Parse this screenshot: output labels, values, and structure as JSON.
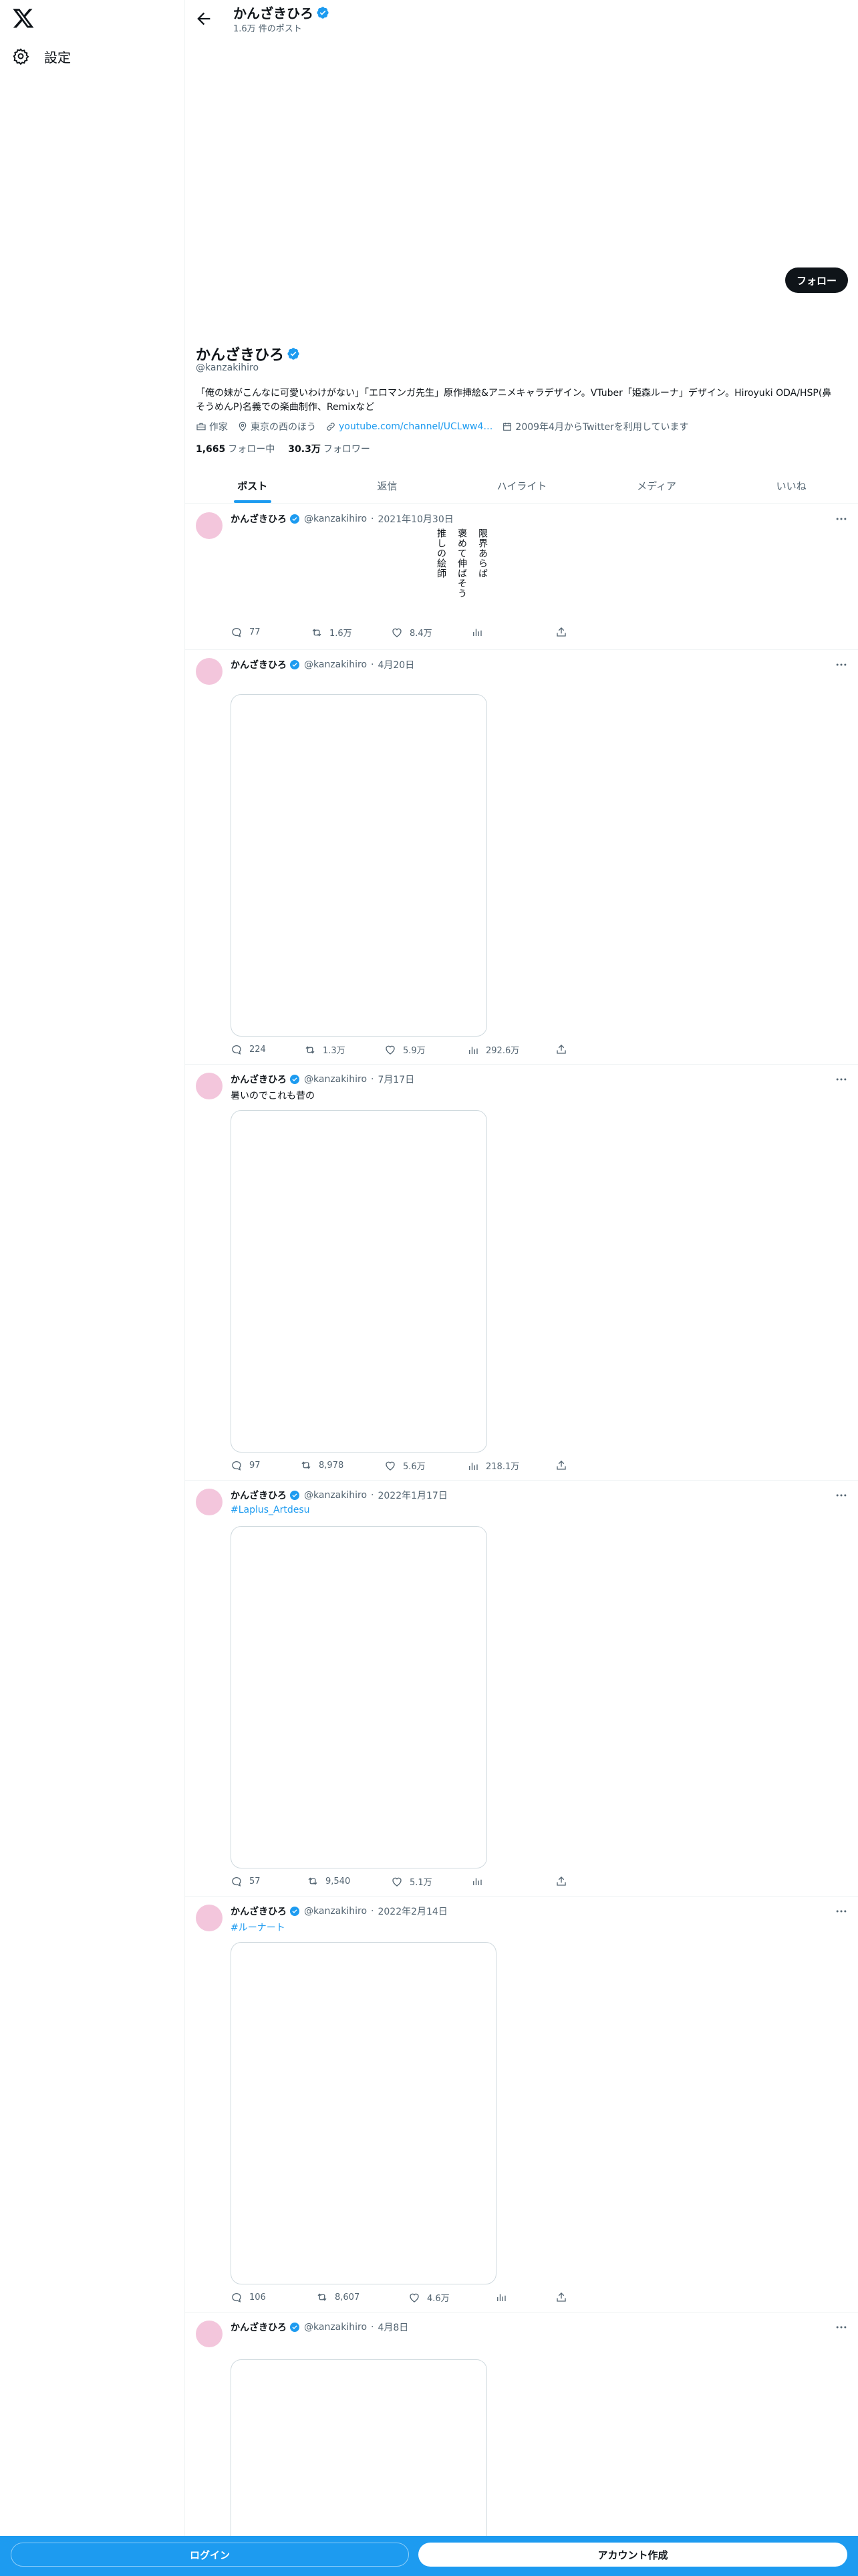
{
  "nav": {
    "settings_label": "設定"
  },
  "header": {
    "title": "かんざきひろ",
    "subtitle": "1.6万 件のポスト"
  },
  "profile": {
    "follow_label": "フォロー",
    "name": "かんざきひろ",
    "handle": "@kanzakihiro",
    "bio": "「俺の妹がこんなに可愛いわけがない」「エロマンガ先生」原作挿絵&アニメキャラデザイン。VTuber「姫森ルーナ」デザイン。Hiroyuki ODA/HSP(鼻そうめんP)名義での楽曲制作、Remixなど",
    "job": "作家",
    "location": "東京の西のほう",
    "link": "youtube.com/channel/UCLww4…",
    "joined": "2009年4月からTwitterを利用しています",
    "following_count": "1,665",
    "following_label": "フォロー中",
    "followers_count": "30.3万",
    "followers_label": "フォロワー"
  },
  "tabs": [
    "ポスト",
    "返信",
    "ハイライト",
    "メディア",
    "いいね"
  ],
  "posts": [
    {
      "name": "かんざきひろ",
      "handle": "@kanzakihiro",
      "sep": "·",
      "date": "2021年10月30日",
      "poem": [
        "推しの絵師",
        "褒めて伸ばそう",
        "限界あらば"
      ],
      "replies": "77",
      "reposts": "1.6万",
      "likes": "8.4万",
      "views": ""
    },
    {
      "name": "かんざきひろ",
      "handle": "@kanzakihiro",
      "sep": "·",
      "date": "4月20日",
      "replies": "224",
      "reposts": "1.3万",
      "likes": "5.9万",
      "views": "292.6万"
    },
    {
      "name": "かんざきひろ",
      "handle": "@kanzakihiro",
      "sep": "·",
      "date": "7月17日",
      "text": "暑いのでこれも昔の",
      "replies": "97",
      "reposts": "8,978",
      "likes": "5.6万",
      "views": "218.1万"
    },
    {
      "name": "かんざきひろ",
      "handle": "@kanzakihiro",
      "sep": "·",
      "date": "2022年1月17日",
      "tag": "#Laplus_Artdesu",
      "replies": "57",
      "reposts": "9,540",
      "likes": "5.1万",
      "views": ""
    },
    {
      "name": "かんざきひろ",
      "handle": "@kanzakihiro",
      "sep": "·",
      "date": "2022年2月14日",
      "tag": "#ルーナート",
      "replies": "106",
      "reposts": "8,607",
      "likes": "4.6万",
      "views": ""
    },
    {
      "name": "かんざきひろ",
      "handle": "@kanzakihiro",
      "sep": "·",
      "date": "4月8日"
    }
  ],
  "bottom": {
    "login_label": "ログイン",
    "signup_label": "アカウント作成"
  },
  "colors": {
    "accent": "#1d9bf0",
    "text": "#0f1419",
    "muted": "#536471",
    "border": "#eff3f4"
  }
}
